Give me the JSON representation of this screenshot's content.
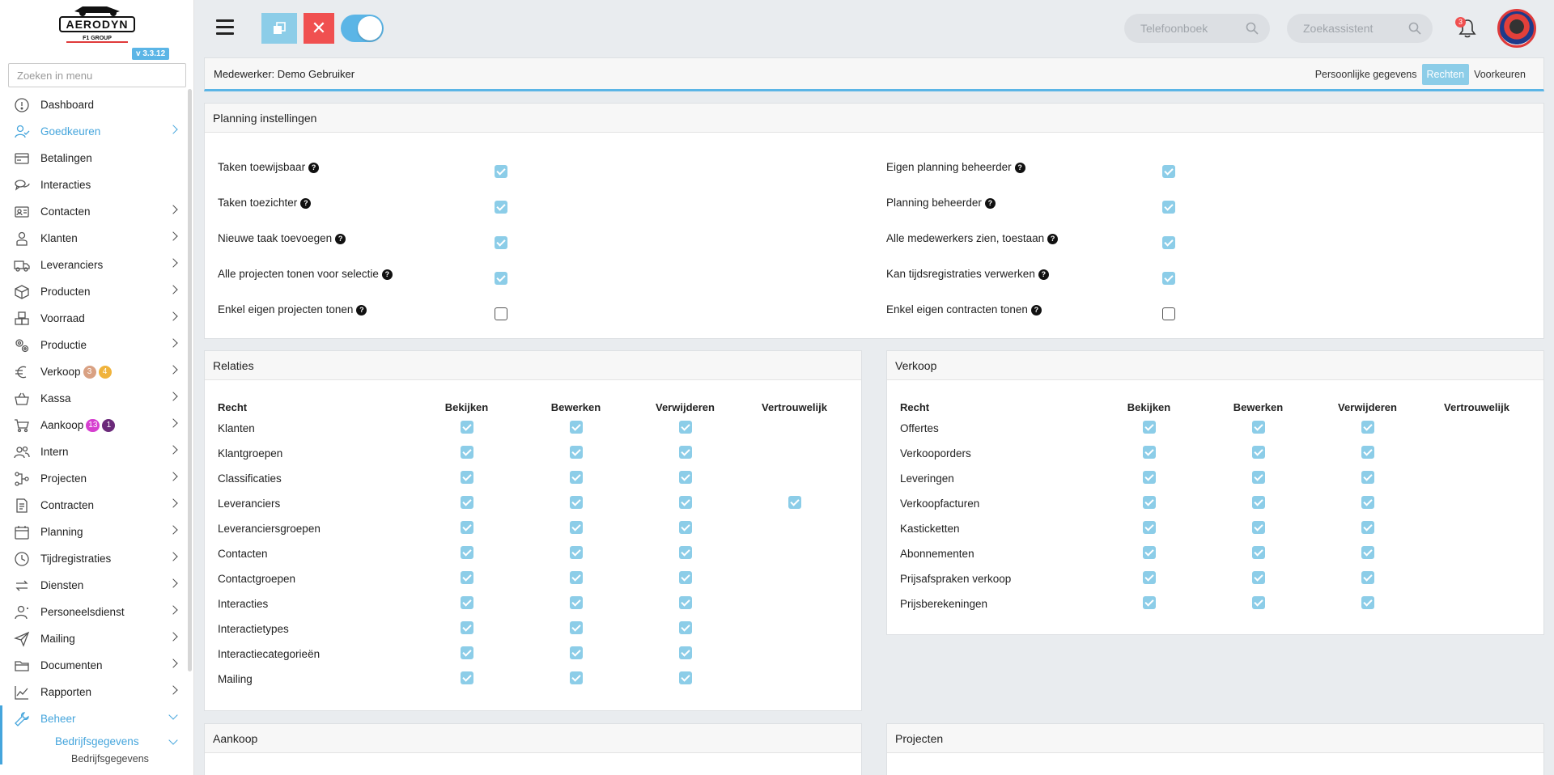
{
  "app": {
    "logo_text": "AERODYN",
    "logo_subtext": "F1 GROUP",
    "version": "v 3.3.12"
  },
  "sidebar": {
    "search_placeholder": "Zoeken in menu",
    "items": [
      {
        "label": "Dashboard",
        "icon": "dashboard-icon",
        "chevron": false
      },
      {
        "label": "Goedkeuren",
        "icon": "user-check-icon",
        "chevron": true,
        "highlight": true
      },
      {
        "label": "Betalingen",
        "icon": "payment-icon",
        "chevron": false
      },
      {
        "label": "Interacties",
        "icon": "chat-icon",
        "chevron": false
      },
      {
        "label": "Contacten",
        "icon": "contact-card-icon",
        "chevron": true
      },
      {
        "label": "Klanten",
        "icon": "customer-icon",
        "chevron": true
      },
      {
        "label": "Leveranciers",
        "icon": "truck-icon",
        "chevron": true
      },
      {
        "label": "Producten",
        "icon": "box-icon",
        "chevron": true
      },
      {
        "label": "Voorraad",
        "icon": "boxes-icon",
        "chevron": true
      },
      {
        "label": "Productie",
        "icon": "gears-icon",
        "chevron": true
      },
      {
        "label": "Verkoop",
        "icon": "euro-icon",
        "chevron": true,
        "badges": [
          {
            "text": "3",
            "color": "#d9a183"
          },
          {
            "text": "4",
            "color": "#f0b33c"
          }
        ]
      },
      {
        "label": "Kassa",
        "icon": "basket-icon",
        "chevron": true
      },
      {
        "label": "Aankoop",
        "icon": "cart-icon",
        "chevron": true,
        "badges": [
          {
            "text": "13",
            "color": "#d63fd0"
          },
          {
            "text": "1",
            "color": "#6b2a7a"
          }
        ]
      },
      {
        "label": "Intern",
        "icon": "users-icon",
        "chevron": true
      },
      {
        "label": "Projecten",
        "icon": "project-icon",
        "chevron": true
      },
      {
        "label": "Contracten",
        "icon": "contract-icon",
        "chevron": true
      },
      {
        "label": "Planning",
        "icon": "calendar-icon",
        "chevron": true
      },
      {
        "label": "Tijdregistraties",
        "icon": "clock-icon",
        "chevron": true
      },
      {
        "label": "Diensten",
        "icon": "arrows-icon",
        "chevron": true
      },
      {
        "label": "Personeelsdienst",
        "icon": "staff-icon",
        "chevron": true
      },
      {
        "label": "Mailing",
        "icon": "send-icon",
        "chevron": true
      },
      {
        "label": "Documenten",
        "icon": "folder-icon",
        "chevron": true
      },
      {
        "label": "Rapporten",
        "icon": "chart-icon",
        "chevron": true
      },
      {
        "label": "Beheer",
        "icon": "wrench-icon",
        "chevron": true,
        "expanded": true,
        "highlight": true
      }
    ],
    "sub_item": "Bedrijfsgegevens",
    "subsub_item": "Bedrijfsgegevens"
  },
  "topbar": {
    "phonebook_placeholder": "Telefoonboek",
    "assistant_placeholder": "Zoekassistent",
    "notification_count": "3",
    "toggle_on": true
  },
  "employee": {
    "title": "Medewerker: Demo Gebruiker",
    "tabs": [
      "Persoonlijke gegevens",
      "Rechten",
      "Voorkeuren"
    ],
    "active_tab": 1
  },
  "planning": {
    "title": "Planning instellingen",
    "left": [
      {
        "label": "Taken toewijsbaar",
        "checked": true
      },
      {
        "label": "Taken toezichter",
        "checked": true
      },
      {
        "label": "Nieuwe taak toevoegen",
        "checked": true
      },
      {
        "label": "Alle projecten tonen voor selectie",
        "checked": true
      },
      {
        "label": "Enkel eigen projecten tonen",
        "checked": false
      }
    ],
    "right": [
      {
        "label": "Eigen planning beheerder",
        "checked": true
      },
      {
        "label": "Planning beheerder",
        "checked": true
      },
      {
        "label": "Alle medewerkers zien, toestaan",
        "checked": true
      },
      {
        "label": "Kan tijdsregistraties verwerken",
        "checked": true
      },
      {
        "label": "Enkel eigen contracten tonen",
        "checked": false
      }
    ]
  },
  "relaties": {
    "title": "Relaties",
    "columns": [
      "Recht",
      "Bekijken",
      "Bewerken",
      "Verwijderen",
      "Vertrouwelijk"
    ],
    "rows": [
      {
        "label": "Klanten",
        "checks": [
          true,
          true,
          true,
          null
        ]
      },
      {
        "label": "Klantgroepen",
        "checks": [
          true,
          true,
          true,
          null
        ]
      },
      {
        "label": "Classificaties",
        "checks": [
          true,
          true,
          true,
          null
        ]
      },
      {
        "label": "Leveranciers",
        "checks": [
          true,
          true,
          true,
          true
        ]
      },
      {
        "label": "Leveranciersgroepen",
        "checks": [
          true,
          true,
          true,
          null
        ]
      },
      {
        "label": "Contacten",
        "checks": [
          true,
          true,
          true,
          null
        ]
      },
      {
        "label": "Contactgroepen",
        "checks": [
          true,
          true,
          true,
          null
        ]
      },
      {
        "label": "Interacties",
        "checks": [
          true,
          true,
          true,
          null
        ]
      },
      {
        "label": "Interactietypes",
        "checks": [
          true,
          true,
          true,
          null
        ]
      },
      {
        "label": "Interactiecategorieën",
        "checks": [
          true,
          true,
          true,
          null
        ]
      },
      {
        "label": "Mailing",
        "checks": [
          true,
          true,
          true,
          null
        ]
      }
    ]
  },
  "verkoop": {
    "title": "Verkoop",
    "columns": [
      "Recht",
      "Bekijken",
      "Bewerken",
      "Verwijderen",
      "Vertrouwelijk"
    ],
    "rows": [
      {
        "label": "Offertes",
        "checks": [
          true,
          true,
          true,
          null
        ]
      },
      {
        "label": "Verkooporders",
        "checks": [
          true,
          true,
          true,
          null
        ]
      },
      {
        "label": "Leveringen",
        "checks": [
          true,
          true,
          true,
          null
        ]
      },
      {
        "label": "Verkoopfacturen",
        "checks": [
          true,
          true,
          true,
          null
        ]
      },
      {
        "label": "Kasticketten",
        "checks": [
          true,
          true,
          true,
          null
        ]
      },
      {
        "label": "Abonnementen",
        "checks": [
          true,
          true,
          true,
          null
        ]
      },
      {
        "label": "Prijsafspraken verkoop",
        "checks": [
          true,
          true,
          true,
          null
        ]
      },
      {
        "label": "Prijsberekeningen",
        "checks": [
          true,
          true,
          true,
          null
        ]
      }
    ]
  },
  "aankoop": {
    "title": "Aankoop"
  },
  "projecten": {
    "title": "Projecten"
  },
  "colors": {
    "accent": "#45a5dc",
    "checkbox": "#8ccde8",
    "danger": "#f05050"
  }
}
